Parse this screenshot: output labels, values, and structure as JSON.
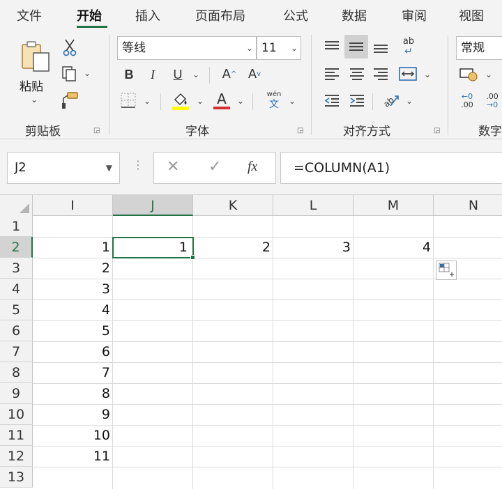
{
  "menu": {
    "tabs": [
      {
        "label": "文件"
      },
      {
        "label": "开始"
      },
      {
        "label": "插入"
      },
      {
        "label": "页面布局"
      },
      {
        "label": "公式"
      },
      {
        "label": "数据"
      },
      {
        "label": "审阅"
      },
      {
        "label": "视图"
      }
    ],
    "active_tab": "开始"
  },
  "ribbon": {
    "clipboard": {
      "paste_label": "粘贴",
      "group_label": "剪贴板"
    },
    "font": {
      "font_name": "等线",
      "font_size": "11",
      "bold": "B",
      "italic": "I",
      "underline": "U",
      "grow": "A",
      "shrink": "A",
      "font_color_glyph": "A",
      "phonetic_top": "wén",
      "phonetic_bottom": "文",
      "group_label": "字体"
    },
    "alignment": {
      "group_label": "对齐方式",
      "wrap_glyph": "ab"
    },
    "number": {
      "format": "常规",
      "group_label": "数字",
      "inc_decimal": ".00",
      "dec_decimal": ".00"
    }
  },
  "formula_bar": {
    "name_box": "J2",
    "cancel_glyph": "✕",
    "enter_glyph": "✓",
    "fx_glyph": "fx",
    "formula": "=COLUMN(A1)"
  },
  "sheet": {
    "columns": [
      "I",
      "J",
      "K",
      "L",
      "M",
      "N"
    ],
    "selected_column": "J",
    "rows": [
      "1",
      "2",
      "3",
      "4",
      "5",
      "6",
      "7",
      "8",
      "9",
      "10",
      "11",
      "12",
      "13"
    ],
    "selected_row": "2",
    "active_cell": "J2",
    "cells": {
      "I2": "1",
      "I3": "2",
      "I4": "3",
      "I5": "4",
      "I6": "5",
      "I7": "6",
      "I8": "7",
      "I9": "8",
      "I10": "9",
      "I11": "10",
      "I12": "11",
      "J2": "1",
      "K2": "2",
      "L2": "3",
      "M2": "4"
    }
  },
  "colors": {
    "accent": "#217346",
    "font_color_bar": "#ffff00",
    "underline_red": "#d32f2f"
  }
}
